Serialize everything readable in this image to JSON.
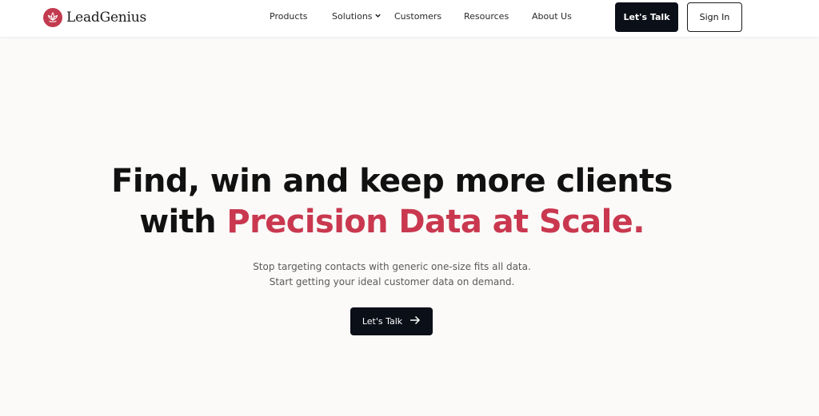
{
  "brand": {
    "name": "LeadGenius",
    "icon": "lotus-logo-icon",
    "color": "#c23a4f"
  },
  "nav": {
    "items": [
      "Products",
      "Solutions",
      "Customers",
      "Resources",
      "About Us"
    ],
    "solutions_icon": "chevron-down-icon"
  },
  "header_actions": {
    "talk_label": "Let's Talk",
    "signin_label": "Sign In"
  },
  "hero": {
    "title_line1": "Find, win and keep more clients",
    "title_line2_prefix": "with ",
    "title_line2_accent": "Precision Data at Scale.",
    "accent_color": "#c9384f",
    "subtitle_line1": "Stop targeting contacts with generic one-size fits all data.",
    "subtitle_line2": "Start getting your ideal customer data on demand.",
    "cta_label": "Let's Talk",
    "cta_icon": "arrow-right-icon"
  }
}
